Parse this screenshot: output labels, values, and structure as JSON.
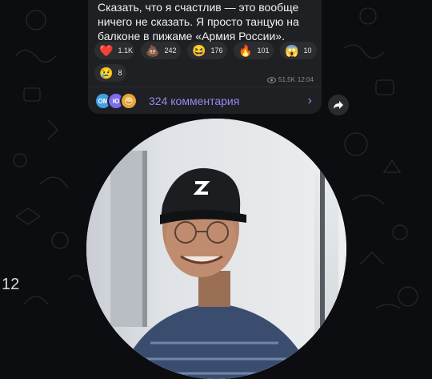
{
  "message": {
    "text": "Сказать, что я счастлив — это вообще ничего не сказать. Я просто танцую на балконе в пижаме «Армия России».",
    "reactions": [
      {
        "emoji": "❤️",
        "count": "1.1K"
      },
      {
        "emoji": "💩",
        "count": "242"
      },
      {
        "emoji": "😆",
        "count": "176"
      },
      {
        "emoji": "🔥",
        "count": "101"
      },
      {
        "emoji": "😱",
        "count": "10"
      },
      {
        "emoji": "😢",
        "count": "8"
      }
    ],
    "views": "51,5K",
    "time": "12:04"
  },
  "comments": {
    "avatars": [
      "ОМ",
      "Ю",
      ""
    ],
    "label": "324 комментария"
  },
  "video_note": {
    "subject": "man-in-white-cap"
  },
  "side": {
    "partial_time": "12"
  },
  "colors": {
    "accent": "#8f8cf0",
    "bubble": "#1f2023",
    "background": "#0c0d10"
  }
}
